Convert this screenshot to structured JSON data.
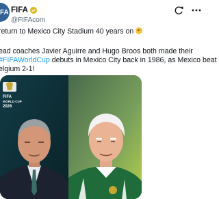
{
  "tweet": {
    "author": {
      "name": "FIFA",
      "handle": "@FIFAcom",
      "avatar_text": "IFA"
    },
    "text_line1": "return to Mexico City Stadium 40 years on",
    "text_line2": "ead coaches Javier Aguirre and Hugo Broos both made their",
    "hashtag": "FIFAWorldCup",
    "text_line3_after": " debuts in Mexico City back in 1986, as Mexico beat",
    "text_line4": "elgium 2-1!",
    "icons": {
      "verified": "verified-badge-icon",
      "grok": "grok-icon",
      "more": "more-icon",
      "emoji": "smiling-face-icon"
    },
    "media": {
      "logo_text_1": "FIFA",
      "logo_text_2": "WORLD CUP",
      "logo_text_3": "2026"
    }
  }
}
